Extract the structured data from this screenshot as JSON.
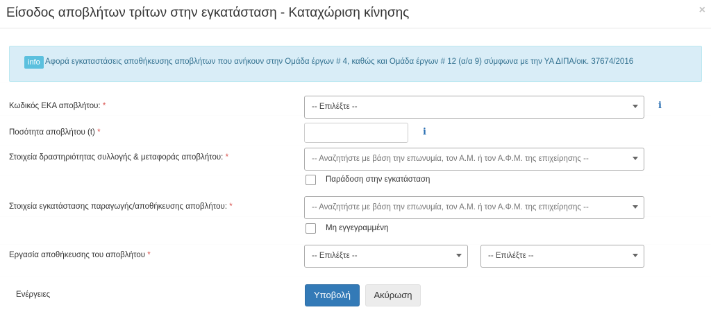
{
  "modal": {
    "title": "Είσοδος αποβλήτων τρίτων στην εγκατάσταση - Καταχώριση κίνησης",
    "close_symbol": "×"
  },
  "info": {
    "badge": "info",
    "text": "Αφορά εγκαταστάσεις αποθήκευσης αποβλήτων που ανήκουν στην Ομάδα έργων # 4, καθώς και Ομάδα έργων # 12 (α/α 9) σύμφωνα με την ΥΑ ΔΙΠΑ/οικ. 37674/2016"
  },
  "form": {
    "eka": {
      "label": "Κωδικός ΕΚΑ αποβλήτου:",
      "required": "*",
      "value": "-- Επιλέξτε --"
    },
    "quantity": {
      "label": "Ποσότητα αποβλήτου (t)",
      "required": "*",
      "value": ""
    },
    "collection": {
      "label": "Στοιχεία δραστηριότητας συλλογής & μεταφοράς αποβλήτου:",
      "required": "*",
      "placeholder": "-- Αναζητήστε με βάση την επωνυμία, τον Α.Μ. ή τον Α.Φ.Μ. της επιχείρησης --"
    },
    "delivery_checkbox_label": "Παράδοση στην εγκατάσταση",
    "facility": {
      "label": "Στοιχεία εγκατάστασης παραγωγής/αποθήκευσης αποβλήτου:",
      "required": "*",
      "placeholder": "-- Αναζητήστε με βάση την επωνυμία, τον Α.Μ. ή τον Α.Φ.Μ. της επιχείρησης --"
    },
    "unregistered_checkbox_label": "Μη εγγεγραμμένη",
    "storage_work": {
      "label": "Εργασία αποθήκευσης του αποβλήτου",
      "required": "*",
      "first_value": "-- Επιλέξτε --",
      "second_value": "-- Επιλέξτε --"
    },
    "actions": {
      "label": "Ενέργειες",
      "submit": "Υποβολή",
      "cancel": "Ακύρωση"
    }
  },
  "icons": {
    "info_glyph": "i"
  },
  "colors": {
    "primary": "#337ab7",
    "info_bg": "#d9edf7",
    "info_text": "#31708f",
    "required": "#d9534f"
  }
}
